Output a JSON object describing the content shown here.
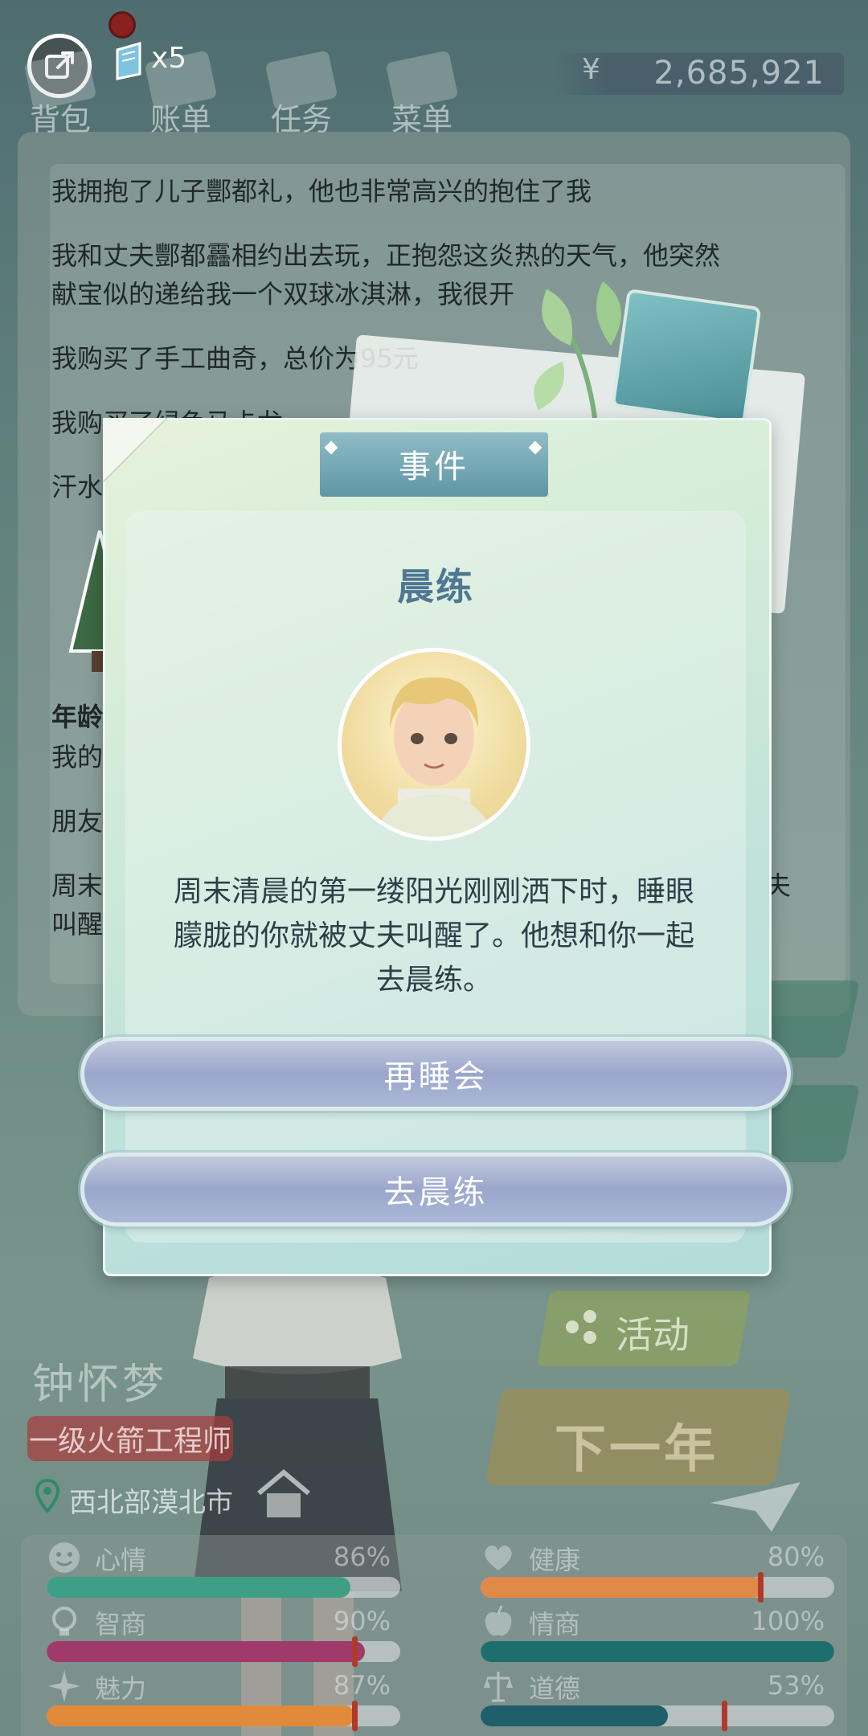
{
  "topbar": {
    "ticket_count": "x5",
    "nav": [
      "背包",
      "账单",
      "任务",
      "菜单"
    ],
    "currency_symbol": "¥",
    "money": "2,685,921"
  },
  "log": {
    "lines": [
      "我拥抱了儿子酆都礼，他也非常高兴的抱住了我",
      "我和丈夫酆都靐相约出去玩，正抱怨这炎热的天气，他突然",
      "献宝似的递给我一个双球冰淇淋，我很开",
      "我购买了手工曲奇，总价为95元",
      "我购买了绿色马卡龙",
      "汗水",
      "年龄",
      "我的",
      "朋友",
      "周末",
      "叫醒",
      "夫"
    ]
  },
  "dialog": {
    "header": "事件",
    "event_title": "晨练",
    "description": "周末清晨的第一缕阳光刚刚洒下时，睡眼朦胧的你就被丈夫叫醒了。他想和你一起去晨练。",
    "choices": [
      "再睡会",
      "去晨练"
    ]
  },
  "character": {
    "name": "钟怀梦",
    "job": "一级火箭工程师",
    "location": "西北部漠北市"
  },
  "actions": {
    "activity": "活动",
    "next_year": "下一年"
  },
  "stats": [
    {
      "name": "心情",
      "value": "86%",
      "level": 0.86,
      "color": "#3f9e86",
      "icon": "smile-icon"
    },
    {
      "name": "健康",
      "value": "80%",
      "level": 0.8,
      "color": "#e08a4a",
      "icon": "heart-icon"
    },
    {
      "name": "智商",
      "value": "90%",
      "level": 0.9,
      "color": "#a03a6a",
      "icon": "lightbulb-icon"
    },
    {
      "name": "情商",
      "value": "100%",
      "level": 1.0,
      "color": "#1f6e6e",
      "icon": "apple-icon"
    },
    {
      "name": "魅力",
      "value": "87%",
      "level": 0.87,
      "color": "#e08a3a",
      "icon": "sparkle-icon"
    },
    {
      "name": "道德",
      "value": "53%",
      "level": 0.53,
      "color": "#1f5f6a",
      "icon": "scales-icon"
    }
  ]
}
